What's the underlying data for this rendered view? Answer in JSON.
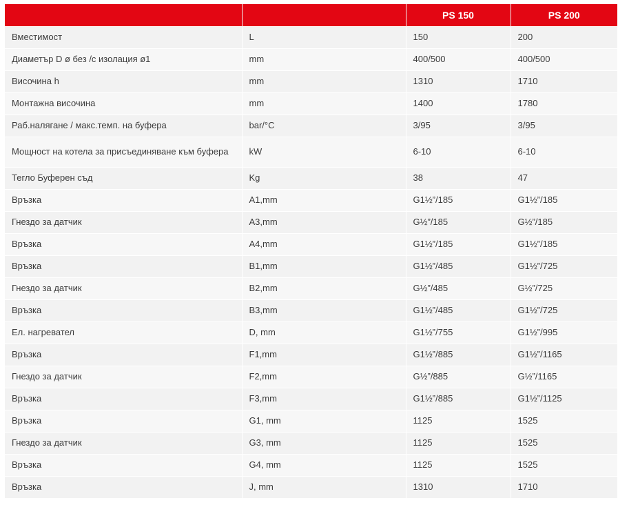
{
  "header": {
    "param_label": "",
    "unit_label": "",
    "model_1": "PS 150",
    "model_2": "PS 200"
  },
  "rows": [
    {
      "param": "Вместимост",
      "unit": "L",
      "ps150": "150",
      "ps200": "200"
    },
    {
      "param": "Диаметър D ø без /с изолация ø1",
      "unit": "mm",
      "ps150": "400/500",
      "ps200": "400/500"
    },
    {
      "param": "Височина h",
      "unit": "mm",
      "ps150": "1310",
      "ps200": "1710"
    },
    {
      "param": "Монтажна височина",
      "unit": "mm",
      "ps150": "1400",
      "ps200": "1780"
    },
    {
      "param": "Раб.налягане / макс.темп. на буфера",
      "unit": "bar/°C",
      "ps150": "3/95",
      "ps200": "3/95"
    },
    {
      "param": "Мощност на котела за присъединяване към буфера",
      "unit": "kW",
      "ps150": "6-10",
      "ps200": "6-10"
    },
    {
      "param": "Тегло Буферен съд",
      "unit": "Kg",
      "ps150": "38",
      "ps200": "47"
    },
    {
      "param": "Връзка",
      "unit": "A1,mm",
      "ps150": "G1½”/185",
      "ps200": "G1½”/185"
    },
    {
      "param": "Гнездо за датчик",
      "unit": "A3,mm",
      "ps150": "G½”/185",
      "ps200": "G½”/185"
    },
    {
      "param": "Връзка",
      "unit": "A4,mm",
      "ps150": "G1½”/185",
      "ps200": "G1½”/185"
    },
    {
      "param": "Връзка",
      "unit": "B1,mm",
      "ps150": "G1½”/485",
      "ps200": "G1½”/725"
    },
    {
      "param": "Гнездо за датчик",
      "unit": "B2,mm",
      "ps150": "G½”/485",
      "ps200": "G½”/725"
    },
    {
      "param": "Връзка",
      "unit": "B3,mm",
      "ps150": "G1½”/485",
      "ps200": "G1½”/725"
    },
    {
      "param": "Ел. нагревател",
      "unit": "D, mm",
      "ps150": "G1½”/755",
      "ps200": "G1½”/995"
    },
    {
      "param": "Връзка",
      "unit": "F1,mm",
      "ps150": "G1½”/885",
      "ps200": "G1½”/1165"
    },
    {
      "param": "Гнездо за датчик",
      "unit": "F2,mm",
      "ps150": "G½”/885",
      "ps200": "G½”/1165"
    },
    {
      "param": "Връзка",
      "unit": "F3,mm",
      "ps150": "G1½”/885",
      "ps200": "G1½”/1125"
    },
    {
      "param": "Връзка",
      "unit": "G1, mm",
      "ps150": "1125",
      "ps200": "1525"
    },
    {
      "param": "Гнездо за датчик",
      "unit": "G3, mm",
      "ps150": "1125",
      "ps200": "1525"
    },
    {
      "param": "Връзка",
      "unit": "G4, mm",
      "ps150": "1125",
      "ps200": "1525"
    },
    {
      "param": "Връзка",
      "unit": "J, mm",
      "ps150": "1310",
      "ps200": "1710"
    }
  ],
  "colors": {
    "header_bg": "#e30613",
    "header_text": "#ffffff",
    "row_bg_odd": "#f2f2f2",
    "row_bg_even": "#f7f7f7",
    "cell_text": "#3c3c3c"
  }
}
